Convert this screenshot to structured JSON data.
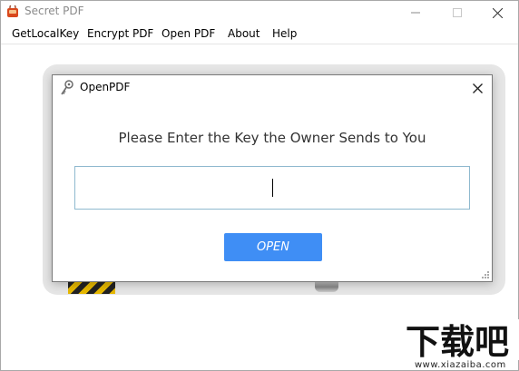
{
  "window": {
    "title": "Secret PDF",
    "minimize_icon": "minimize-icon",
    "maximize_icon": "maximize-icon",
    "close_icon": "close-icon"
  },
  "menu": {
    "items": [
      {
        "label": "GetLocalKey"
      },
      {
        "label": "Encrypt PDF"
      },
      {
        "label": "Open PDF"
      },
      {
        "label": "About"
      },
      {
        "label": "Help"
      }
    ]
  },
  "dialog": {
    "title": "OpenPDF",
    "prompt": "Please Enter the Key the Owner Sends to You",
    "key_value": "",
    "open_label": "OPEN",
    "accent_color": "#3f8ef5",
    "input_border_color": "#8fb9cf"
  },
  "watermark": {
    "logo_text": "下载吧",
    "url": "www.xiazaiba.com"
  }
}
